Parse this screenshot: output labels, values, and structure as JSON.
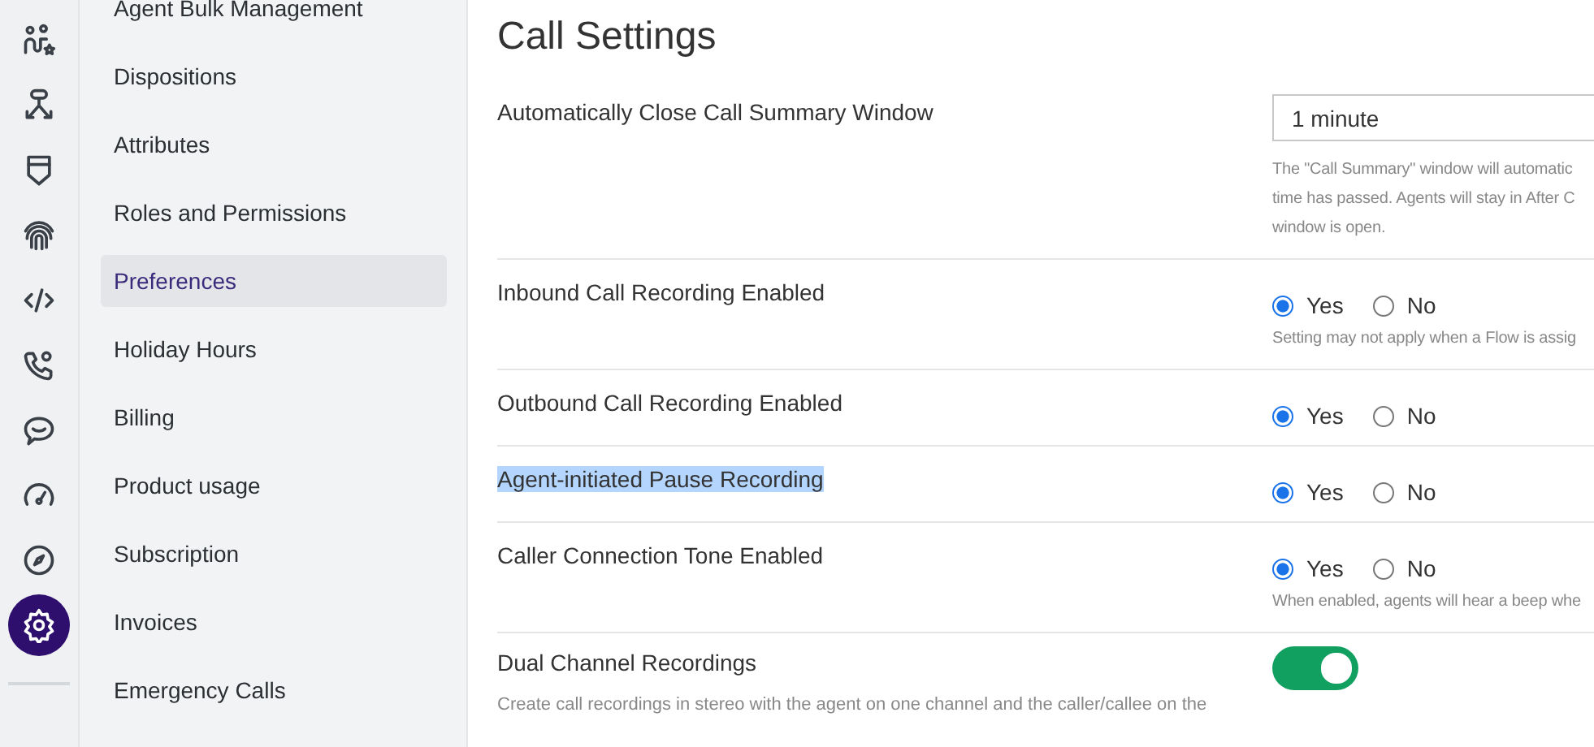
{
  "rail": {
    "items": [
      {
        "selected": false
      },
      {
        "selected": false
      },
      {
        "selected": false
      },
      {
        "selected": false
      },
      {
        "selected": false
      },
      {
        "selected": false
      },
      {
        "selected": false
      },
      {
        "selected": false
      },
      {
        "selected": false
      },
      {
        "selected": true
      }
    ]
  },
  "nav": {
    "items": [
      {
        "label": "Agent Bulk Management",
        "selected": false
      },
      {
        "label": "Dispositions",
        "selected": false
      },
      {
        "label": "Attributes",
        "selected": false
      },
      {
        "label": "Roles and Permissions",
        "selected": false
      },
      {
        "label": "Preferences",
        "selected": true
      },
      {
        "label": "Holiday Hours",
        "selected": false
      },
      {
        "label": "Billing",
        "selected": false
      },
      {
        "label": "Product usage",
        "selected": false
      },
      {
        "label": "Subscription",
        "selected": false
      },
      {
        "label": "Invoices",
        "selected": false
      },
      {
        "label": "Emergency Calls",
        "selected": false
      }
    ]
  },
  "page": {
    "title": "Call Settings",
    "settings": [
      {
        "kind": "select",
        "label": "Automatically Close Call Summary Window",
        "highlighted": false,
        "value": "1 minute",
        "help": [
          "The \"Call Summary\" window will automatic",
          "time has passed. Agents will stay in After C",
          "window is open."
        ]
      },
      {
        "kind": "radio",
        "label": "Inbound Call Recording Enabled",
        "highlighted": false,
        "options": [
          {
            "label": "Yes",
            "selected": true
          },
          {
            "label": "No",
            "selected": false
          }
        ],
        "help": [
          "Setting may not apply when a Flow is assig"
        ]
      },
      {
        "kind": "radio",
        "label": "Outbound Call Recording Enabled",
        "highlighted": false,
        "options": [
          {
            "label": "Yes",
            "selected": true
          },
          {
            "label": "No",
            "selected": false
          }
        ]
      },
      {
        "kind": "radio",
        "label": "Agent-initiated Pause Recording",
        "highlighted": true,
        "options": [
          {
            "label": "Yes",
            "selected": true
          },
          {
            "label": "No",
            "selected": false
          }
        ]
      },
      {
        "kind": "radio",
        "label": "Caller Connection Tone Enabled",
        "highlighted": false,
        "options": [
          {
            "label": "Yes",
            "selected": true
          },
          {
            "label": "No",
            "selected": false
          }
        ],
        "help": [
          "When enabled, agents will hear a beep whe"
        ]
      },
      {
        "kind": "toggle",
        "label": "Dual Channel Recordings",
        "highlighted": false,
        "on": true,
        "description": "Create call recordings in stereo with the agent on one channel and the caller/callee on the"
      }
    ]
  }
}
